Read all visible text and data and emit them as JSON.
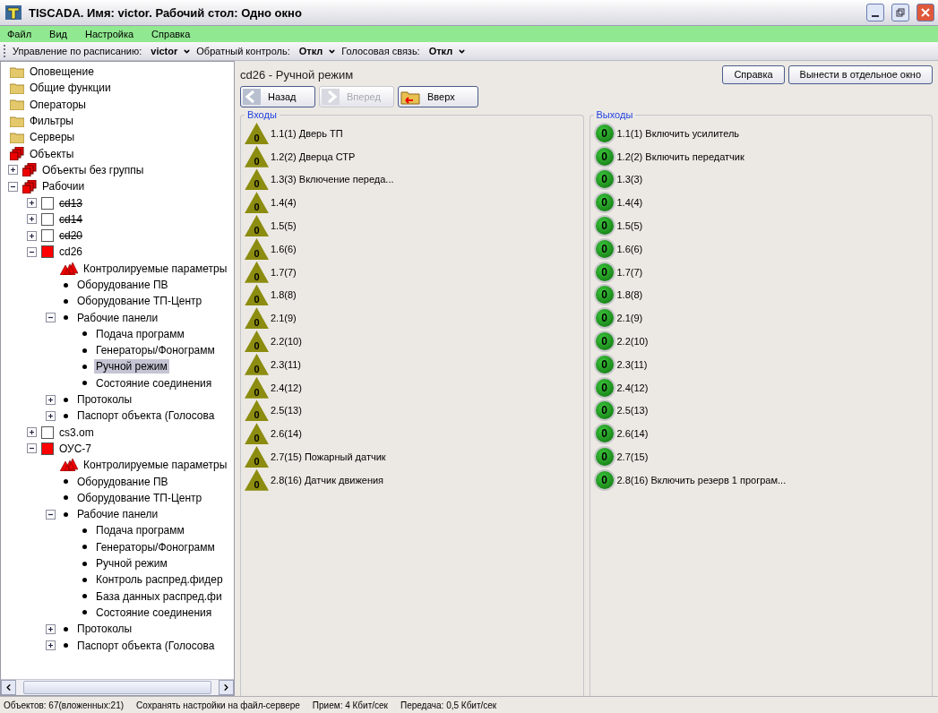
{
  "window": {
    "title": "TISCADA.  Имя: victor.  Рабочий стол: Одно окно"
  },
  "menu": [
    {
      "label": "Файл"
    },
    {
      "label": "Вид"
    },
    {
      "label": "Настройка"
    },
    {
      "label": "Справка"
    }
  ],
  "toolbar": [
    {
      "label": "Управление по расписанию:",
      "value": "victor"
    },
    {
      "label": "Обратный контроль:",
      "value": "Откл"
    },
    {
      "label": "Голосовая связь:",
      "value": "Откл"
    }
  ],
  "tree": [
    {
      "label": "Оповещение",
      "kind": "folder",
      "selected": false
    },
    {
      "label": "Общие функции",
      "kind": "folder",
      "selected": false
    },
    {
      "label": "Операторы",
      "kind": "folder",
      "selected": false
    },
    {
      "label": "Фильтры",
      "kind": "folder",
      "selected": false
    },
    {
      "label": "Серверы",
      "kind": "folder",
      "selected": false
    },
    {
      "label": "Объекты",
      "kind": "group",
      "selected": false,
      "children": [
        {
          "label": "Объекты без группы",
          "kind": "group",
          "selected": false,
          "expanded": false
        },
        {
          "label": "Рабочии",
          "kind": "group",
          "selected": false,
          "expanded": true,
          "children": [
            {
              "label": "cd13",
              "kind": "object",
              "color": "#ffffff",
              "disabled": true,
              "selected": false,
              "expanded": false
            },
            {
              "label": "cd14",
              "kind": "object",
              "color": "#ffffff",
              "disabled": true,
              "selected": false,
              "expanded": false
            },
            {
              "label": "cd20",
              "kind": "object",
              "color": "#ffffff",
              "disabled": true,
              "selected": false,
              "expanded": false
            },
            {
              "label": "cd26",
              "kind": "object",
              "color": "#ff0000",
              "disabled": false,
              "selected": false,
              "expanded": true,
              "children": [
                {
                  "label": "Контролируемые параметры",
                  "kind": "param",
                  "selected": false
                },
                {
                  "label": "Оборудование ПВ",
                  "kind": "node",
                  "selected": false
                },
                {
                  "label": "Оборудование ТП-Центр",
                  "kind": "node",
                  "selected": false
                },
                {
                  "label": "Рабочие панели",
                  "kind": "node",
                  "selected": false,
                  "expanded": true,
                  "children": [
                    {
                      "label": "Подача программ",
                      "kind": "node",
                      "selected": false
                    },
                    {
                      "label": "Генераторы/Фонограмм",
                      "kind": "node",
                      "selected": false
                    },
                    {
                      "label": "Ручной режим",
                      "kind": "node",
                      "selected": true
                    },
                    {
                      "label": "Состояние соединения",
                      "kind": "node",
                      "selected": false
                    }
                  ]
                },
                {
                  "label": "Протоколы",
                  "kind": "node",
                  "selected": false,
                  "expanded": false
                },
                {
                  "label": "Паспорт объекта (Голосова",
                  "kind": "node",
                  "selected": false,
                  "expanded": false
                }
              ]
            },
            {
              "label": "cs3.om",
              "kind": "object",
              "color": "#ffffff",
              "disabled": false,
              "selected": false,
              "expanded": false
            },
            {
              "label": "ОУС-7",
              "kind": "object",
              "color": "#ff0000",
              "disabled": false,
              "selected": false,
              "expanded": true,
              "children": [
                {
                  "label": "Контролируемые параметры",
                  "kind": "param",
                  "selected": false
                },
                {
                  "label": "Оборудование ПВ",
                  "kind": "node",
                  "selected": false
                },
                {
                  "label": "Оборудование ТП-Центр",
                  "kind": "node",
                  "selected": false
                },
                {
                  "label": "Рабочие панели",
                  "kind": "node",
                  "selected": false,
                  "expanded": true,
                  "children": [
                    {
                      "label": "Подача программ",
                      "kind": "node",
                      "selected": false
                    },
                    {
                      "label": "Генераторы/Фонограмм",
                      "kind": "node",
                      "selected": false
                    },
                    {
                      "label": "Ручной режим",
                      "kind": "node",
                      "selected": false
                    },
                    {
                      "label": "Контроль распред.фидер",
                      "kind": "node",
                      "selected": false
                    },
                    {
                      "label": "База данных распред.фи",
                      "kind": "node",
                      "selected": false
                    },
                    {
                      "label": "Состояние соединения",
                      "kind": "node",
                      "selected": false
                    }
                  ]
                },
                {
                  "label": "Протоколы",
                  "kind": "node",
                  "selected": false,
                  "expanded": false
                },
                {
                  "label": "Паспорт объекта (Голосова",
                  "kind": "node",
                  "selected": false,
                  "expanded": false
                }
              ]
            }
          ]
        }
      ]
    }
  ],
  "panel": {
    "title": "cd26 - Ручной режим",
    "actions": [
      {
        "label": "Справка"
      },
      {
        "label": "Вынести в отдельное окно"
      }
    ],
    "nav": [
      {
        "label": "Назад",
        "kind": "back",
        "disabled": false
      },
      {
        "label": "Вперед",
        "kind": "forward",
        "disabled": true
      },
      {
        "label": "Вверх",
        "kind": "up",
        "disabled": false
      }
    ],
    "inputs": {
      "title": "Входы",
      "items": [
        {
          "value": "0",
          "label": "1.1(1) Дверь ТП"
        },
        {
          "value": "0",
          "label": "1.2(2) Дверца СТР"
        },
        {
          "value": "0",
          "label": "1.3(3) Включение переда..."
        },
        {
          "value": "0",
          "label": "1.4(4)"
        },
        {
          "value": "0",
          "label": "1.5(5)"
        },
        {
          "value": "0",
          "label": "1.6(6)"
        },
        {
          "value": "0",
          "label": "1.7(7)"
        },
        {
          "value": "0",
          "label": "1.8(8)"
        },
        {
          "value": "0",
          "label": "2.1(9)"
        },
        {
          "value": "0",
          "label": "2.2(10)"
        },
        {
          "value": "0",
          "label": "2.3(11)"
        },
        {
          "value": "0",
          "label": "2.4(12)"
        },
        {
          "value": "0",
          "label": "2.5(13)"
        },
        {
          "value": "0",
          "label": "2.6(14)"
        },
        {
          "value": "0",
          "label": "2.7(15) Пожарный датчик"
        },
        {
          "value": "0",
          "label": "2.8(16) Датчик движения"
        }
      ]
    },
    "outputs": {
      "title": "Выходы",
      "items": [
        {
          "value": "0",
          "label": "1.1(1) Включить усилитель"
        },
        {
          "value": "0",
          "label": "1.2(2) Включить передатчик"
        },
        {
          "value": "0",
          "label": "1.3(3)"
        },
        {
          "value": "0",
          "label": "1.4(4)"
        },
        {
          "value": "0",
          "label": "1.5(5)"
        },
        {
          "value": "0",
          "label": "1.6(6)"
        },
        {
          "value": "0",
          "label": "1.7(7)"
        },
        {
          "value": "0",
          "label": "1.8(8)"
        },
        {
          "value": "0",
          "label": "2.1(9)"
        },
        {
          "value": "0",
          "label": "2.2(10)"
        },
        {
          "value": "0",
          "label": "2.3(11)"
        },
        {
          "value": "0",
          "label": "2.4(12)"
        },
        {
          "value": "0",
          "label": "2.5(13)"
        },
        {
          "value": "0",
          "label": "2.6(14)"
        },
        {
          "value": "0",
          "label": "2.7(15)"
        },
        {
          "value": "0",
          "label": "2.8(16) Включить резерв 1 програм..."
        }
      ]
    }
  },
  "status_bar": [
    {
      "text": "Объектов: 67(вложенных:21)"
    },
    {
      "text": "Сохранять настройки на файл-сервере"
    },
    {
      "text": "Прием: 4 Кбит/сек"
    },
    {
      "text": "Передача: 0,5 Кбит/сек"
    }
  ]
}
